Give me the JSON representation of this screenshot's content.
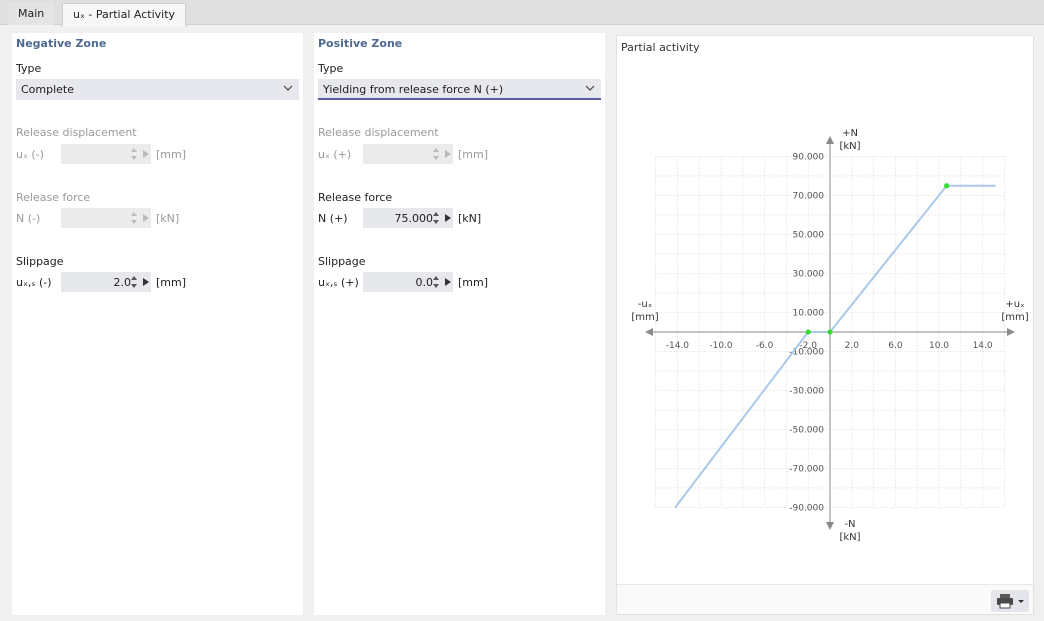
{
  "tabs": [
    {
      "label": "Main"
    },
    {
      "label": "uₓ - Partial Activity"
    }
  ],
  "negative_zone": {
    "title": "Negative Zone",
    "type_label": "Type",
    "type_value": "Complete",
    "release_displacement_label": "Release displacement",
    "release_displacement_symbol": "uₓ (-)",
    "release_displacement_unit": "[mm]",
    "release_force_label": "Release force",
    "release_force_symbol": "N (-)",
    "release_force_unit": "[kN]",
    "slippage_label": "Slippage",
    "slippage_symbol": "uₓ,ₛ (-)",
    "slippage_value": "2.0",
    "slippage_unit": "[mm]"
  },
  "positive_zone": {
    "title": "Positive Zone",
    "type_label": "Type",
    "type_value": "Yielding from release force N (+)",
    "release_displacement_label": "Release displacement",
    "release_displacement_symbol": "uₓ (+)",
    "release_displacement_unit": "[mm]",
    "release_force_label": "Release force",
    "release_force_symbol": "N (+)",
    "release_force_value": "75.000",
    "release_force_unit": "[kN]",
    "slippage_label": "Slippage",
    "slippage_symbol": "uₓ,ₛ (+)",
    "slippage_value": "0.0",
    "slippage_unit": "[mm]"
  },
  "chart": {
    "title": "Partial activity",
    "x_pos_label": "+uₓ",
    "x_pos_unit": "[mm]",
    "x_neg_label": "-uₓ",
    "x_neg_unit": "[mm]",
    "y_pos_label": "+N",
    "y_pos_unit": "[kN]",
    "y_neg_label": "-N",
    "y_neg_unit": "[kN]",
    "line_color": "#a9c8ea",
    "point_color": "#33dd33"
  },
  "chart_data": {
    "type": "line",
    "title": "Partial activity",
    "x_ticks": [
      "-14.0",
      "-10.0",
      "-6.0",
      "-2.0",
      "2.0",
      "6.0",
      "10.0",
      "14.0"
    ],
    "x_tick_values": [
      -14,
      -10,
      -6,
      -2,
      2,
      6,
      10,
      14
    ],
    "y_ticks": [
      "90.000",
      "70.000",
      "50.000",
      "30.000",
      "10.000",
      "-10.000",
      "-30.000",
      "-50.000",
      "-70.000",
      "-90.000"
    ],
    "y_tick_values": [
      90,
      70,
      50,
      30,
      10,
      -10,
      -30,
      -50,
      -70,
      -90
    ],
    "xlim": [
      -16,
      16
    ],
    "ylim": [
      -90,
      90
    ],
    "grid": true,
    "series": [
      {
        "x": [
          -14.2,
          -2.0,
          0.0,
          10.7,
          15.2
        ],
        "y": [
          -90,
          0,
          0,
          75,
          75
        ]
      }
    ],
    "markers": [
      {
        "x": -2.0,
        "y": 0
      },
      {
        "x": 0.0,
        "y": 0
      },
      {
        "x": 10.7,
        "y": 75
      }
    ]
  }
}
